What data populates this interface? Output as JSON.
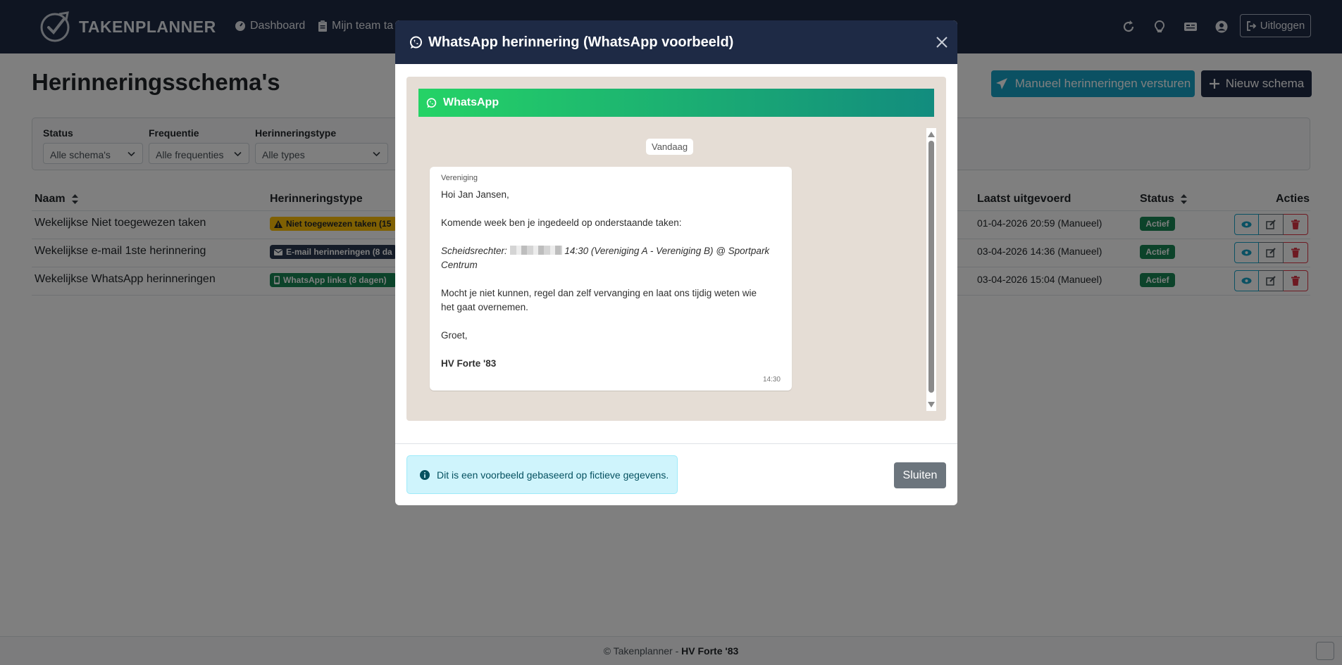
{
  "brand": {
    "name": "TAKENPLANNER"
  },
  "nav": {
    "items": [
      {
        "label": "Dashboard",
        "icon": "gauge-icon"
      },
      {
        "label": "Mijn team ta",
        "icon": "clipboard-icon"
      }
    ],
    "logout_label": "Uitloggen",
    "icons": [
      "refresh-icon",
      "lightbulb-icon",
      "id-card-icon",
      "user-circle-icon"
    ]
  },
  "page": {
    "title": "Herinneringsschema's",
    "send_button": "Manueel herinneringen versturen",
    "new_button": "Nieuw schema"
  },
  "filters": {
    "status": {
      "label": "Status",
      "value": "Alle schema's"
    },
    "frequency": {
      "label": "Frequentie",
      "value": "Alle frequenties"
    },
    "type": {
      "label": "Herinneringstype",
      "value": "Alle types"
    }
  },
  "table": {
    "headers": {
      "name": "Naam",
      "type": "Herinneringstype",
      "last_run": "Laatst uitgevoerd",
      "status": "Status",
      "actions": "Acties"
    },
    "rows": [
      {
        "name": "Wekelijkse Niet toegewezen taken",
        "type_badge": "Niet toegewezen taken (15",
        "last_run": "01-04-2026 20:59 (Manueel)",
        "status": "Actief"
      },
      {
        "name": "Wekelijkse e-mail 1ste herinnering",
        "type_badge": "E-mail herinneringen (8 da",
        "last_run": "03-04-2026 14:36 (Manueel)",
        "status": "Actief"
      },
      {
        "name": "Wekelijkse WhatsApp herinneringen",
        "type_badge": "WhatsApp links (8 dagen)",
        "last_run": "03-04-2026 15:04 (Manueel)",
        "status": "Actief"
      }
    ]
  },
  "footer": {
    "prefix": "© Takenplanner - ",
    "org": "HV Forte '83"
  },
  "modal": {
    "title": "WhatsApp herinnering (WhatsApp voorbeeld)",
    "wa_header": "WhatsApp",
    "date_chip": "Vandaag",
    "message": {
      "sender": "Vereniging",
      "greeting": "Hoi Jan Jansen,",
      "intro": "Komende week ben je ingedeeld op onderstaande taken:",
      "task_prefix": "Scheidsrechter:",
      "task_rest": "14:30 (Vereniging A - Vereniging B) @ Sportpark",
      "task_line2": "Centrum",
      "para1": "Mocht je niet kunnen, regel dan zelf vervanging en laat ons tijdig weten wie",
      "para2": "het gaat overnemen.",
      "closing": "Groet,",
      "signature": "HV Forte '83",
      "time": "14:30"
    },
    "info_text": "Dit is een voorbeeld gebaseerd op fictieve gegevens.",
    "close_button": "Sluiten"
  },
  "colors": {
    "navbar": "#1e2a45",
    "info": "#17a2c6",
    "success": "#198754",
    "warning": "#ffc107",
    "danger": "#dc3545",
    "whatsapp_start": "#25d366",
    "whatsapp_end": "#128c7e"
  }
}
